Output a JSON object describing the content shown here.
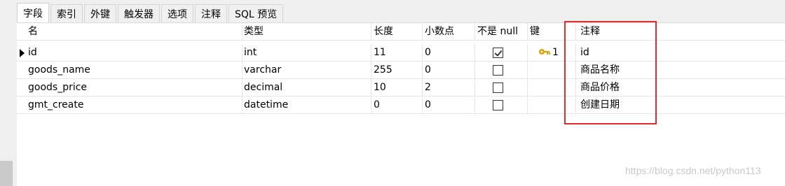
{
  "tabs": [
    {
      "label": "字段",
      "active": true
    },
    {
      "label": "索引",
      "active": false
    },
    {
      "label": "外键",
      "active": false
    },
    {
      "label": "触发器",
      "active": false
    },
    {
      "label": "选项",
      "active": false
    },
    {
      "label": "注释",
      "active": false
    },
    {
      "label": "SQL 预览",
      "active": false
    }
  ],
  "grid": {
    "columns": [
      "名",
      "类型",
      "长度",
      "小数点",
      "不是 null",
      "键",
      "注释"
    ],
    "rows": [
      {
        "name": "id",
        "type": "int",
        "length": "11",
        "decimals": "0",
        "not_null": true,
        "key": "1",
        "comment": "id",
        "current": true
      },
      {
        "name": "goods_name",
        "type": "varchar",
        "length": "255",
        "decimals": "0",
        "not_null": false,
        "key": "",
        "comment": "商品名称",
        "current": false
      },
      {
        "name": "goods_price",
        "type": "decimal",
        "length": "10",
        "decimals": "2",
        "not_null": false,
        "key": "",
        "comment": "商品价格",
        "current": false
      },
      {
        "name": "gmt_create",
        "type": "datetime",
        "length": "0",
        "decimals": "0",
        "not_null": false,
        "key": "",
        "comment": "创建日期",
        "current": false
      }
    ]
  },
  "colors": {
    "highlight": "#e52a2a",
    "key_icon": "#e0a000"
  },
  "watermark": "https://blog.csdn.net/python113"
}
